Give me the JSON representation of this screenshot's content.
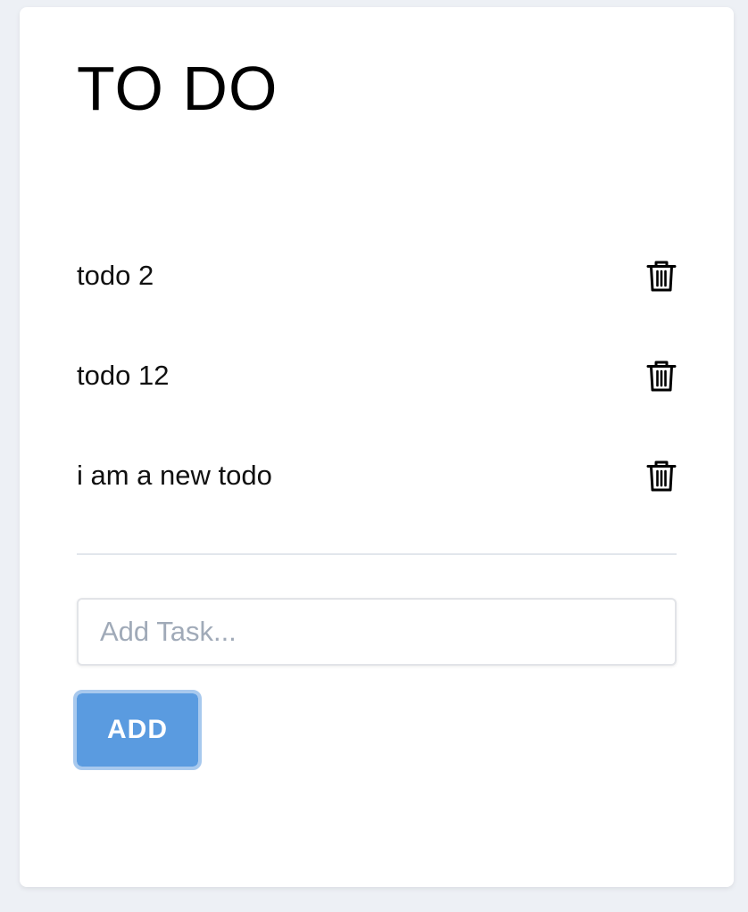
{
  "header": {
    "title": "TO DO"
  },
  "todos": [
    {
      "text": "todo 2",
      "action_icon": "trash-icon"
    },
    {
      "text": "todo 12",
      "action_icon": "trash-icon"
    },
    {
      "text": "i am a new todo",
      "action_icon": "trash-icon"
    }
  ],
  "form": {
    "input_value": "",
    "input_placeholder": "Add Task...",
    "add_label": "ADD"
  },
  "colors": {
    "background": "#edf0f5",
    "card": "#ffffff",
    "accent": "#5a9be0",
    "accent_focus_ring": "#a8c9ee",
    "placeholder": "#a0aab8",
    "divider": "#e2e6ec"
  }
}
